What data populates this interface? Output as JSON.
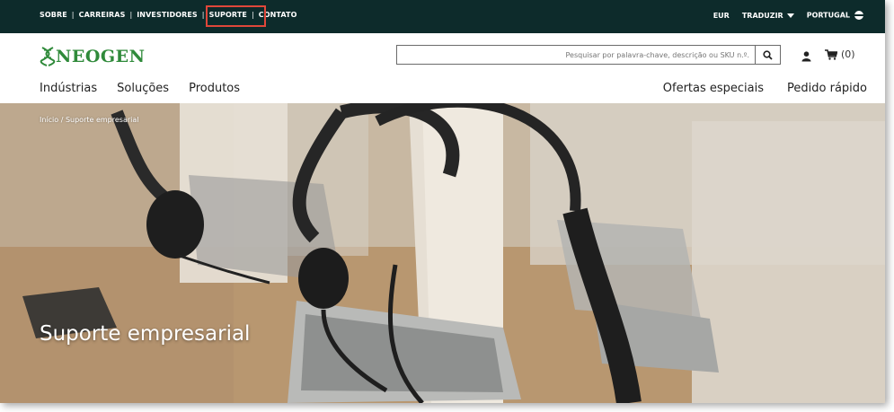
{
  "topbar": {
    "links": [
      "SOBRE",
      "CARREIRAS",
      "INVESTIDORES",
      "SUPORTE",
      "CONTATO"
    ],
    "currency": "EUR",
    "translate": "TRADUZIR",
    "region": "PORTUGAL"
  },
  "header": {
    "logo_text": "NEOGEN",
    "search_placeholder": "Pesquisar por palavra-chave, descrição ou SKU n.º.",
    "cart_count": "(0)",
    "nav_left": [
      "Indústrias",
      "Soluções",
      "Produtos"
    ],
    "nav_right": [
      "Ofertas especiais",
      "Pedido rápido"
    ]
  },
  "hero": {
    "breadcrumb": "Início / Suporte empresarial",
    "title": "Suporte empresarial"
  },
  "colors": {
    "topbar_bg": "#0d2b2b",
    "highlight": "#e0473a",
    "brand_green": "#2f8a3a"
  }
}
